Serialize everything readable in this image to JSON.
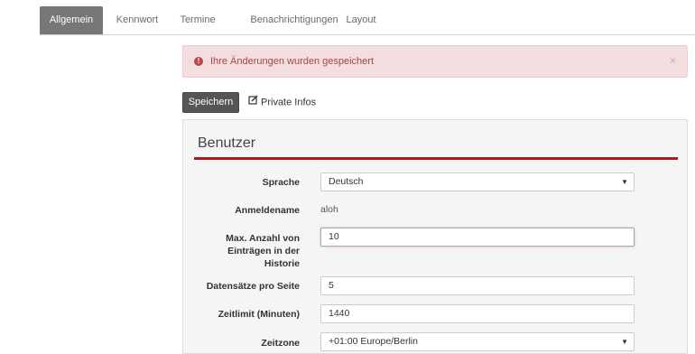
{
  "tabs": [
    {
      "label": "Allgemein",
      "active": true
    },
    {
      "label": "Kennwort",
      "active": false
    },
    {
      "label": "Termine",
      "active": false
    },
    {
      "label": "Benachrichtigungen",
      "active": false
    },
    {
      "label": "Layout",
      "active": false
    }
  ],
  "alert": {
    "text": "Ihre Änderungen wurden gespeichert",
    "close": "×",
    "icon": "exclamation-circle-icon",
    "icon_glyph": "!",
    "color": "#a94442",
    "background": "#f2dede"
  },
  "actions": {
    "save_label": "Speichern",
    "private_label": "Private Infos",
    "private_icon": "edit-icon"
  },
  "panel": {
    "title": "Benutzer",
    "accent": "#b0171f"
  },
  "form": {
    "sprache_label": "Sprache",
    "sprache_value": "Deutsch",
    "anmeldename_label": "Anmeldename",
    "anmeldename_value": "aloh",
    "max_label": "Max. Anzahl von Einträgen in der Historie",
    "max_value": "10",
    "datensaetze_label": "Datensätze pro Seite",
    "datensaetze_value": "5",
    "zeitlimit_label": "Zeitlimit (Minuten)",
    "zeitlimit_value": "1440",
    "zeitzone_label": "Zeitzone",
    "zeitzone_value": "+01:00 Europe/Berlin",
    "select_caret": "▼"
  }
}
